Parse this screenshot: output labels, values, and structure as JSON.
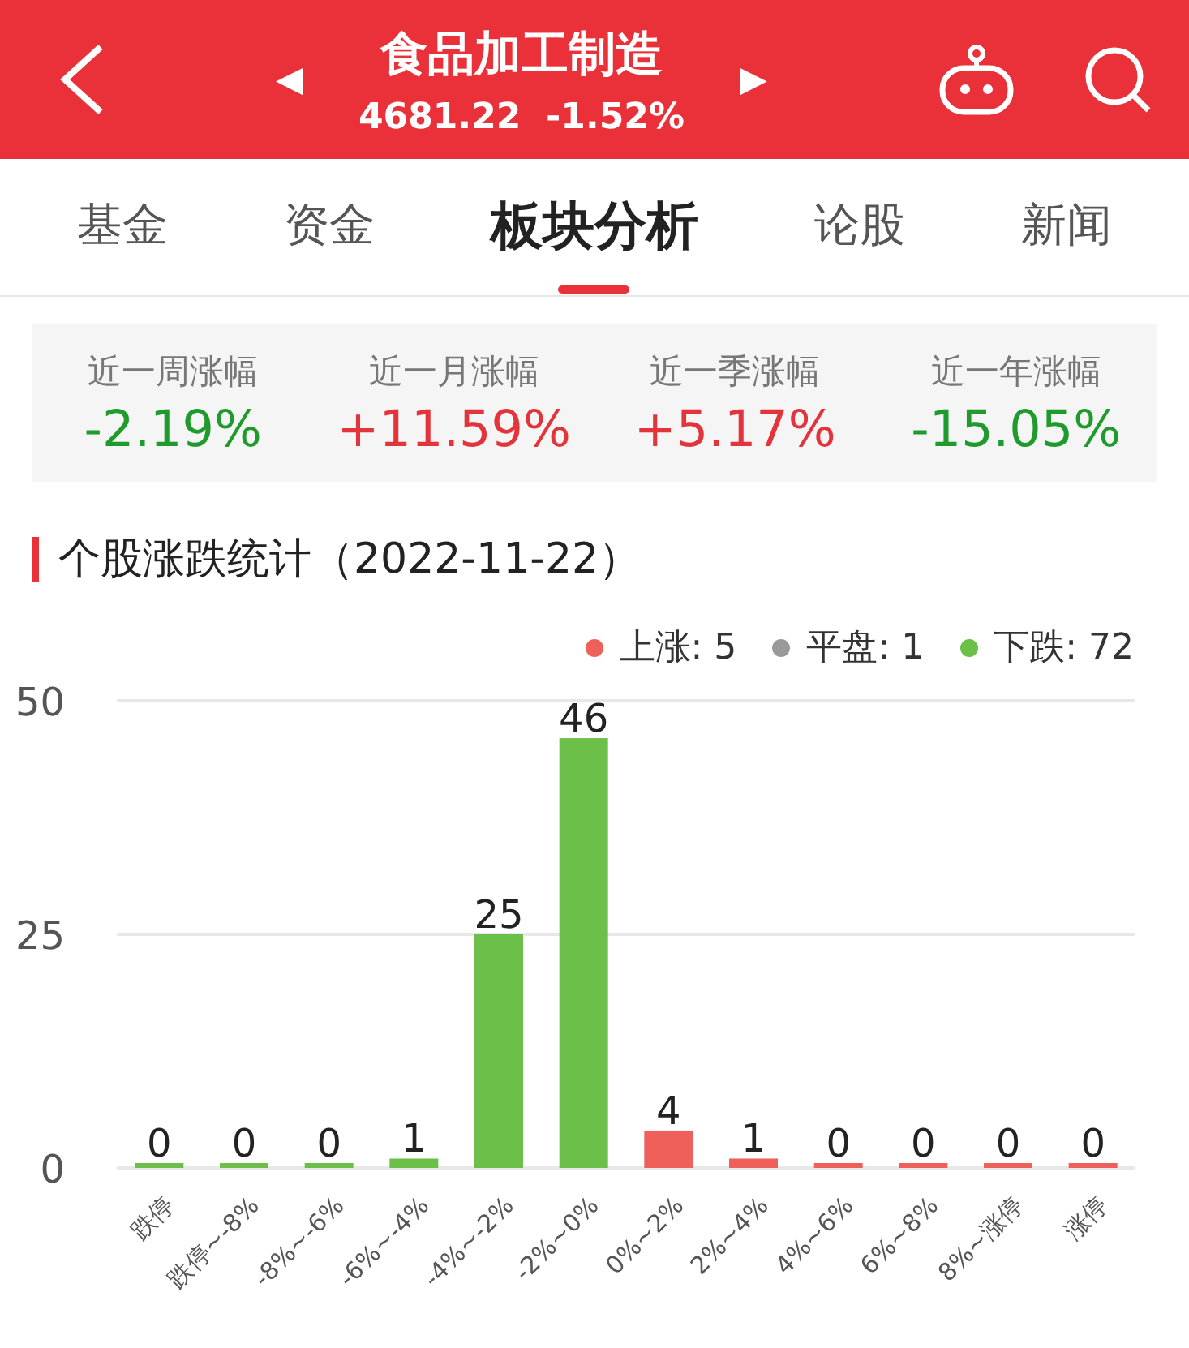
{
  "header": {
    "prev": "◀",
    "title": "食品加工制造",
    "next": "▶",
    "price": "4681.22",
    "change": "-1.52%"
  },
  "tabs": [
    {
      "label": "基金",
      "selected": false
    },
    {
      "label": "资金",
      "selected": false
    },
    {
      "label": "板块分析",
      "selected": true
    },
    {
      "label": "论股",
      "selected": false
    },
    {
      "label": "新闻",
      "selected": false
    }
  ],
  "stats": [
    {
      "label": "近一周涨幅",
      "value": "-2.19%",
      "color": "#1f9a2c"
    },
    {
      "label": "近一月涨幅",
      "value": "+11.59%",
      "color": "#e3333b"
    },
    {
      "label": "近一季涨幅",
      "value": "+5.17%",
      "color": "#e3333b"
    },
    {
      "label": "近一年涨幅",
      "value": "-15.05%",
      "color": "#1f9a2c"
    }
  ],
  "section_title": "个股涨跌统计（2022-11-22）",
  "legend": [
    {
      "label": "上涨: 5",
      "color": "#f0605a"
    },
    {
      "label": "平盘: 1",
      "color": "#999999"
    },
    {
      "label": "下跌: 72",
      "color": "#6cc04a"
    }
  ],
  "chart_data": {
    "type": "bar",
    "data_labels": true,
    "categories": [
      "跌停",
      "跌停~-8%",
      "-8%~-6%",
      "-6%~-4%",
      "-4%~-2%",
      "-2%~0%",
      "0%~2%",
      "2%~4%",
      "4%~6%",
      "6%~8%",
      "8%~涨停",
      "涨停"
    ],
    "ylim": [
      0,
      50
    ],
    "yticks": [
      0,
      25,
      50
    ],
    "series": [
      {
        "color": "#6cc04a",
        "values": [
          0,
          0,
          0,
          1,
          25,
          46,
          null,
          null,
          null,
          null,
          null,
          null
        ]
      },
      {
        "color": "#f0605a",
        "values": [
          null,
          null,
          null,
          null,
          null,
          null,
          4,
          1,
          0,
          0,
          0,
          0
        ]
      }
    ]
  }
}
